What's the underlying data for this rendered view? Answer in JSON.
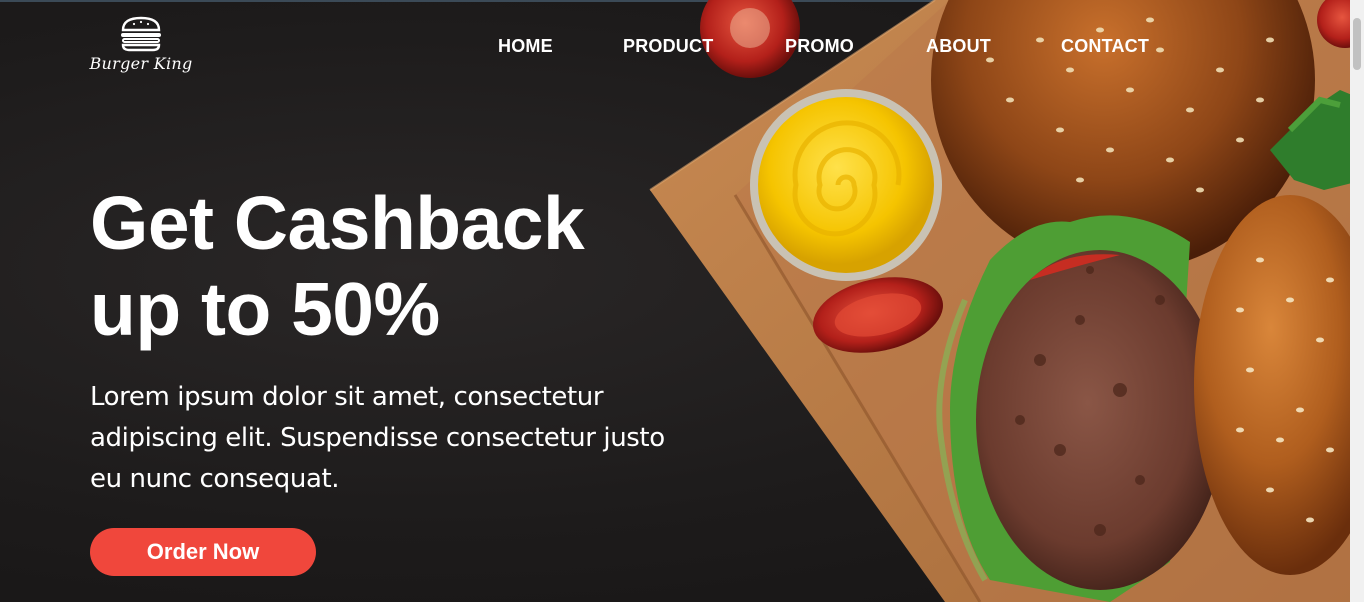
{
  "brand": {
    "name": "Burger King",
    "icon": "burger-icon"
  },
  "nav": {
    "items": [
      {
        "label": "HOME"
      },
      {
        "label": "PRODUCT"
      },
      {
        "label": "PROMO"
      },
      {
        "label": "ABOUT"
      },
      {
        "label": "CONTACT"
      }
    ]
  },
  "hero": {
    "headline_line1": "Get Cashback",
    "headline_line2": "up to 50%",
    "description": "Lorem ipsum dolor sit amet, consectetur adipiscing elit. Suspendisse consectetur justo eu nunc consequat.",
    "cta_label": "Order Now"
  },
  "colors": {
    "accent": "#f0473c",
    "background": "#1c1a1a",
    "text": "#ffffff"
  }
}
